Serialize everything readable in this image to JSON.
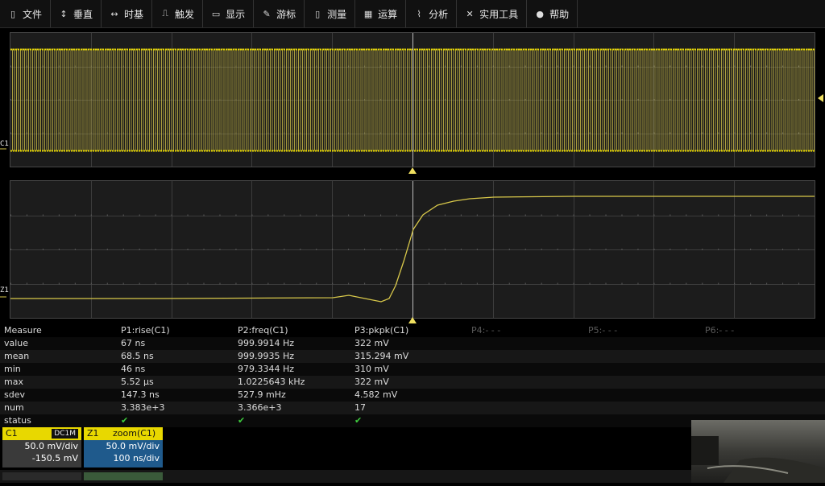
{
  "menu": [
    {
      "label": "文件",
      "icon": "file-icon",
      "glyph": "▯"
    },
    {
      "label": "垂直",
      "icon": "vertical-icon",
      "glyph": "↕"
    },
    {
      "label": "时基",
      "icon": "timebase-icon",
      "glyph": "↔"
    },
    {
      "label": "触发",
      "icon": "trigger-icon",
      "glyph": "⎍"
    },
    {
      "label": "显示",
      "icon": "display-icon",
      "glyph": "▭"
    },
    {
      "label": "游标",
      "icon": "cursor-icon",
      "glyph": "✎"
    },
    {
      "label": "测量",
      "icon": "measure-icon",
      "glyph": "▯"
    },
    {
      "label": "运算",
      "icon": "math-icon",
      "glyph": "▦"
    },
    {
      "label": "分析",
      "icon": "analysis-icon",
      "glyph": "⌇"
    },
    {
      "label": "实用工具",
      "icon": "tools-icon",
      "glyph": "✕"
    },
    {
      "label": "帮助",
      "icon": "help-icon",
      "glyph": "●"
    }
  ],
  "grid1": {
    "channel_label": "C1"
  },
  "grid2": {
    "channel_label": "Z1"
  },
  "measure": {
    "headers": [
      "Measure",
      "P1:rise(C1)",
      "P2:freq(C1)",
      "P3:pkpk(C1)",
      "P4:- - -",
      "P5:- - -",
      "P6:- - -"
    ],
    "rows": [
      {
        "label": "value",
        "p1": "67 ns",
        "p2": "999.9914 Hz",
        "p3": "322 mV"
      },
      {
        "label": "mean",
        "p1": "68.5 ns",
        "p2": "999.9935 Hz",
        "p3": "315.294 mV"
      },
      {
        "label": "min",
        "p1": "46 ns",
        "p2": "979.3344 Hz",
        "p3": "310 mV"
      },
      {
        "label": "max",
        "p1": "5.52 µs",
        "p2": "1.0225643 kHz",
        "p3": "322 mV"
      },
      {
        "label": "sdev",
        "p1": "147.3 ns",
        "p2": "527.9 mHz",
        "p3": "4.582 mV"
      },
      {
        "label": "num",
        "p1": "3.383e+3",
        "p2": "3.366e+3",
        "p3": "17"
      },
      {
        "label": "status",
        "p1": "✔",
        "p2": "✔",
        "p3": "✔"
      }
    ]
  },
  "c1": {
    "name": "C1",
    "coupling": "DC1M",
    "scale": "50.0 mV/div",
    "offset": "-150.5 mV"
  },
  "z1": {
    "name": "Z1",
    "source": "zoom(C1)",
    "scale": "50.0 mV/div",
    "timebase": "100 ns/div"
  },
  "colors": {
    "trace": "#d8c84a",
    "trigger": "#f0e060",
    "grid": "#474747",
    "check": "#3ecb3e"
  }
}
